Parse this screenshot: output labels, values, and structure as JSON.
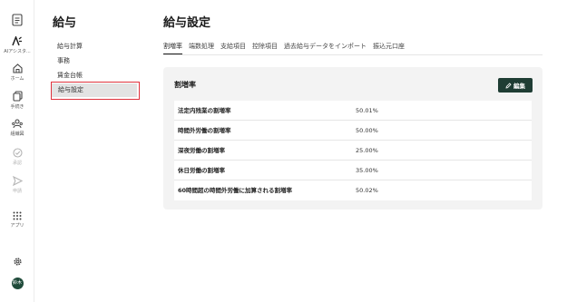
{
  "rail": {
    "items": [
      {
        "label": "",
        "icon": "document-icon"
      },
      {
        "label": "AIアシスタ...",
        "icon": "ai-icon"
      },
      {
        "label": "ホーム",
        "icon": "home-icon"
      },
      {
        "label": "手続き",
        "icon": "procedure-icon"
      },
      {
        "label": "組織図",
        "icon": "org-chart-icon"
      },
      {
        "label": "承認",
        "icon": "approval-icon"
      },
      {
        "label": "申請",
        "icon": "send-icon"
      },
      {
        "label": "アプリ",
        "icon": "apps-grid-icon"
      }
    ],
    "settings_icon": "gear-icon",
    "avatar_text": "鈴木"
  },
  "subnav": {
    "title": "給与",
    "items": [
      {
        "label": "給与計算"
      },
      {
        "label": "事務"
      },
      {
        "label": "賃金台帳"
      },
      {
        "label": "給与設定"
      }
    ]
  },
  "main": {
    "title": "給与設定",
    "tabs": [
      {
        "label": "割増率"
      },
      {
        "label": "端数処理"
      },
      {
        "label": "支給項目"
      },
      {
        "label": "控除項目"
      },
      {
        "label": "過去給与データをインポート"
      },
      {
        "label": "振込元口座"
      }
    ],
    "panel": {
      "title": "割増率",
      "edit_label": "編集",
      "rows": [
        {
          "label": "法定内残業の割増率",
          "value": "50.01%"
        },
        {
          "label": "時間外労働の割増率",
          "value": "50.00%"
        },
        {
          "label": "深夜労働の割増率",
          "value": "25.00%"
        },
        {
          "label": "休日労働の割増率",
          "value": "35.00%"
        },
        {
          "label": "60時間超の時間外労働に加算される割増率",
          "value": "50.02%"
        }
      ]
    }
  },
  "colors": {
    "accent": "#1f3d34",
    "highlight": "#e0323d",
    "active_bg": "#e3e3e3",
    "panel_bg": "#f3f3f3"
  }
}
